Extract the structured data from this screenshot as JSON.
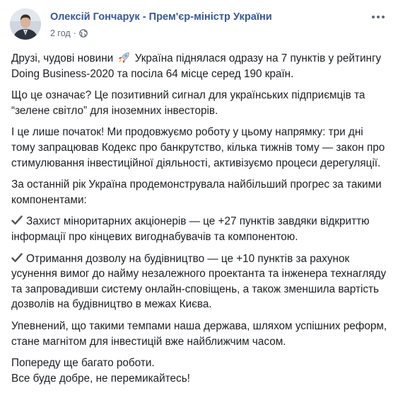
{
  "post": {
    "author": "Олексій Гончарук - Прем'єр-міністр України",
    "time": "2 год",
    "separator": "·",
    "audience_icon": "globe-icon",
    "more_icon": "more-options-icon",
    "paragraphs": [
      {
        "parts": [
          "Друзі, чудові новини",
          "Україна піднялася одразу на 7 пунктів у рейтингу Doing Business-2020 та посіла 64 місце серед 190 країн."
        ],
        "emoji": "rocket-icon"
      },
      "Що це означає? Це позитивний сигнал для українських підприємців та “зелене світло” для іноземних інвесторів.",
      "І це лише початок! Ми продовжуємо роботу у цьому напрямку: три дні тому запрацював Кодекс про банкрутство, кілька тижнів тому — закон про стимулювання інвестиційної діяльності, активізуємо процеси дерегуляції.",
      "За останній рік Україна продемонструвала найбільший прогрес за такими компонентами:",
      "Захист міноритарних акціонерів — це +27 пунктів завдяки відкриттю інформації про кінцевих вигоднабувачів та компонентою.",
      "Отримання дозволу на будівництво — це +10 пунктів за рахунок усунення вимог до найму незалежного проектанта та інженера технагляду та запровадивши систему онлайн-сповіщень, а також зменшила вартість дозволів на будівництво в межах Києва.",
      "Упевнений, що такими темпами наша держава, шляхом успішних реформ, стане магнітом для інвестицій вже найближчим часом.",
      "Попереду ще багато роботи.",
      "Все буде добре, не перемикайтесь!"
    ],
    "check_icon": "check-mark-icon"
  }
}
